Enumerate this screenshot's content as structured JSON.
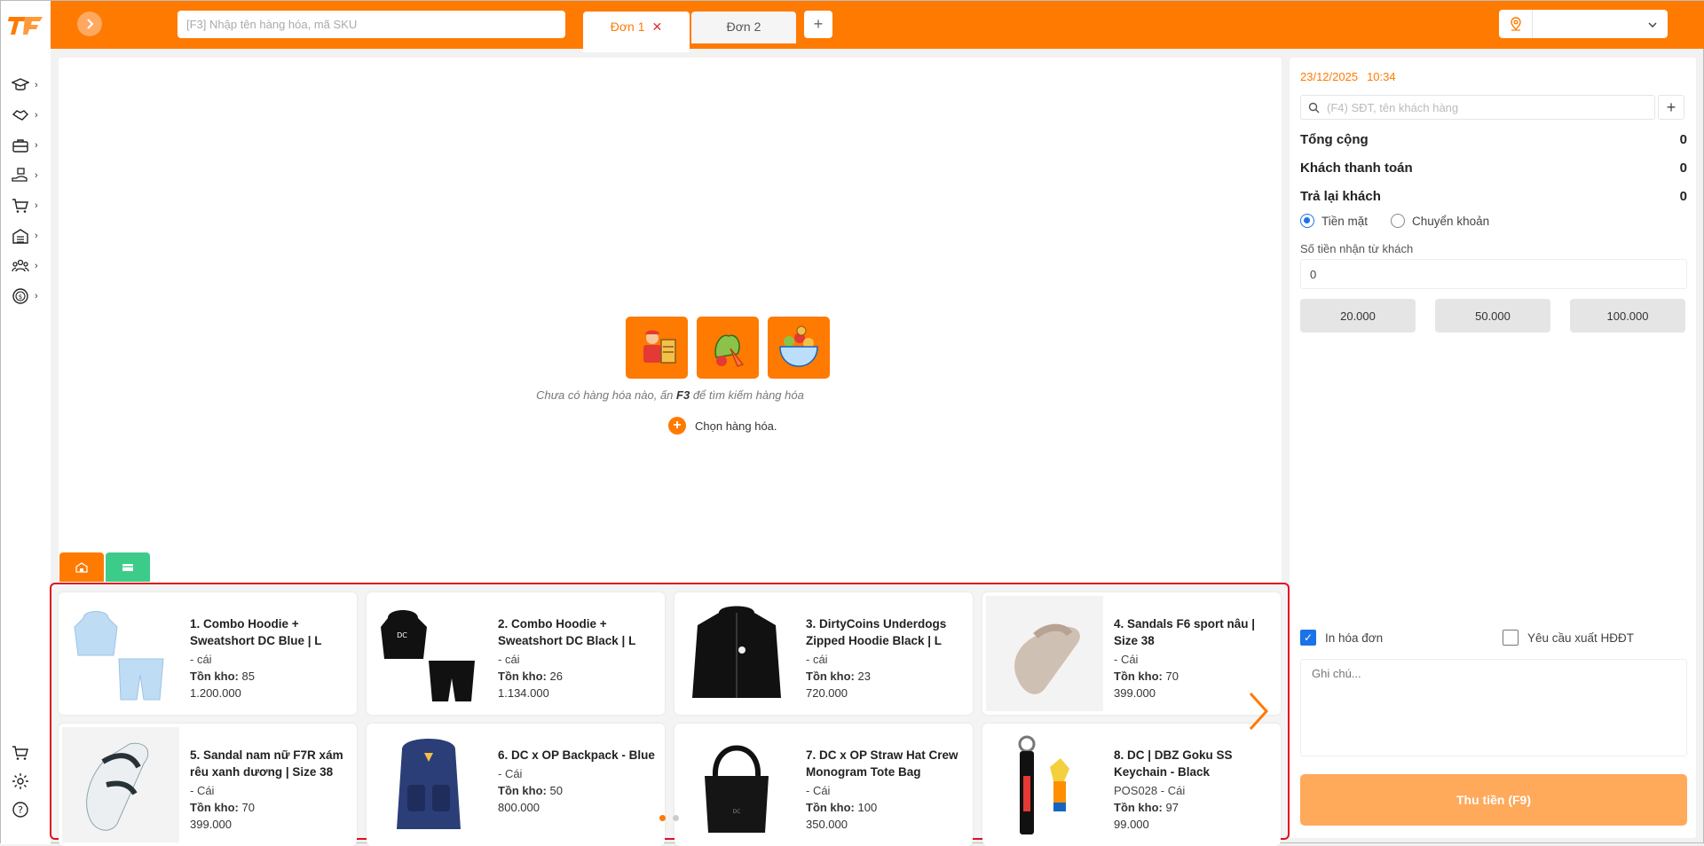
{
  "header": {
    "search_placeholder": "[F3] Nhập tên hàng hóa, mã SKU",
    "tabs": [
      {
        "label": "Đơn 1",
        "active": true
      },
      {
        "label": "Đơn 2",
        "active": false
      }
    ],
    "add_tab_label": "+",
    "location_value": ""
  },
  "sidebar": {
    "items": [
      {
        "icon": "graduation-cap-icon"
      },
      {
        "icon": "handshake-icon"
      },
      {
        "icon": "briefcase-icon"
      },
      {
        "icon": "delivery-hand-icon"
      },
      {
        "icon": "shopping-cart-icon"
      },
      {
        "icon": "warehouse-icon"
      },
      {
        "icon": "users-icon"
      },
      {
        "icon": "dollar-coin-icon"
      }
    ],
    "bottom": [
      {
        "icon": "cart-icon"
      },
      {
        "icon": "gear-icon"
      },
      {
        "icon": "help-icon"
      }
    ]
  },
  "main": {
    "empty_text_before": "Chưa có hàng hóa nào, ấn ",
    "empty_key": "F3",
    "empty_text_after": " để tìm kiếm hàng hóa",
    "choose_label": "Chọn hàng hóa."
  },
  "products": [
    {
      "name": "1. Combo Hoodie + Sweatshort DC Blue | L",
      "unit": " - cái",
      "stock_label": "Tồn kho:",
      "stock": "85",
      "price": "1.200.000",
      "thumb": "hoodie-blue"
    },
    {
      "name": "2. Combo Hoodie + Sweatshort DC Black | L",
      "unit": " - cái",
      "stock_label": "Tồn kho:",
      "stock": "26",
      "price": "1.134.000",
      "thumb": "hoodie-black-set"
    },
    {
      "name": "3. DirtyCoins Underdogs Zipped Hoodie Black | L",
      "unit": " - cái",
      "stock_label": "Tồn kho:",
      "stock": "23",
      "price": "720.000",
      "thumb": "zip-hoodie"
    },
    {
      "name": "4. Sandals F6 sport nâu | Size 38",
      "unit": " - Cái",
      "stock_label": "Tồn kho:",
      "stock": "70",
      "price": "399.000",
      "thumb": "sandal-beige"
    },
    {
      "name": "5. Sandal nam nữ F7R xám rêu xanh dương | Size 38",
      "unit": " - Cái",
      "stock_label": "Tồn kho:",
      "stock": "70",
      "price": "399.000",
      "thumb": "sandal-grey"
    },
    {
      "name": "6. DC x OP Backpack - Blue",
      "unit": " - Cái",
      "stock_label": "Tồn kho:",
      "stock": "50",
      "price": "800.000",
      "thumb": "backpack"
    },
    {
      "name": "7. DC x OP Straw Hat Crew Monogram Tote Bag",
      "unit": " - Cái",
      "stock_label": "Tồn kho:",
      "stock": "100",
      "price": "350.000",
      "thumb": "tote"
    },
    {
      "name": "8. DC | DBZ Goku SS Keychain - Black",
      "unit": "POS028 - Cái",
      "stock_label": "Tồn kho:",
      "stock": "97",
      "price": "99.000",
      "thumb": "keychain"
    }
  ],
  "pagination": {
    "pages": 2,
    "current": 1
  },
  "checkout": {
    "date": "23/12/2025",
    "time": "10:34",
    "customer_placeholder": "(F4) SĐT, tên khách hàng",
    "total_label": "Tổng cộng",
    "total_value": "0",
    "paid_label": "Khách thanh toán",
    "paid_value": "0",
    "change_label": "Trả lại khách",
    "change_value": "0",
    "method_cash": "Tiền mặt",
    "method_transfer": "Chuyển khoản",
    "selected_method": "cash",
    "received_label": "Số tiền nhận từ khách",
    "received_value": "0",
    "quick_amounts": [
      "20.000",
      "50.000",
      "100.000"
    ],
    "print_invoice_label": "In hóa đơn",
    "print_invoice_checked": true,
    "einvoice_label": "Yêu cầu xuất HĐĐT",
    "einvoice_checked": false,
    "note_placeholder": "Ghi chú...",
    "pay_button": "Thu tiền (F9)"
  },
  "colors": {
    "brand": "#ff7a00",
    "pay_button": "#ffa95a",
    "highlight_border": "#e0101e",
    "accent_blue": "#1a73e8"
  }
}
